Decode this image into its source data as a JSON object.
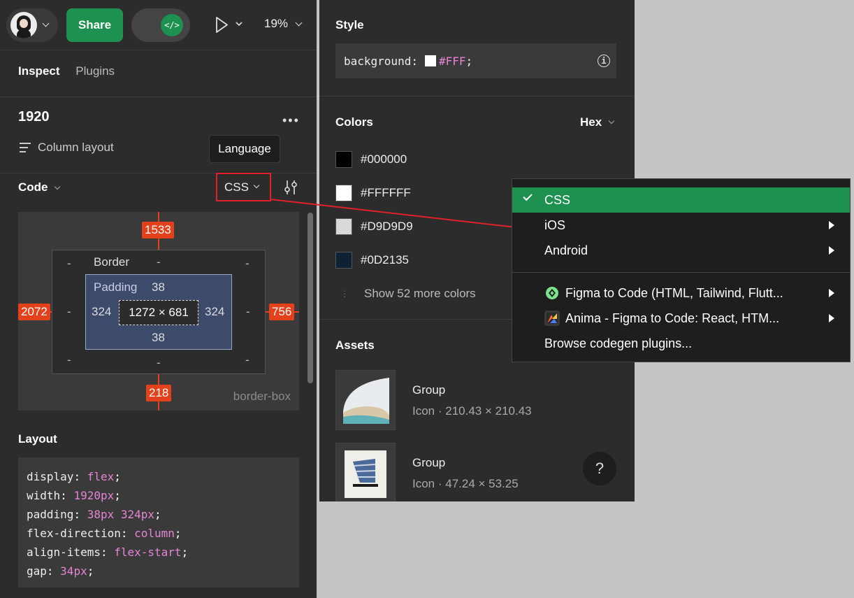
{
  "topbar": {
    "share_label": "Share",
    "zoom_label": "19%"
  },
  "tabs": [
    {
      "label": "Inspect",
      "active": true
    },
    {
      "label": "Plugins",
      "active": false
    }
  ],
  "frame": {
    "name": "1920",
    "layout_label": "Column layout"
  },
  "tooltip": "Language",
  "code_section": {
    "title": "Code",
    "language": "CSS"
  },
  "box_model": {
    "top": "1533",
    "left": "2072",
    "right": "756",
    "bottom": "218",
    "border_label": "Border",
    "padding_label": "Padding",
    "padding_top": "38",
    "padding_left": "324",
    "padding_right": "324",
    "padding_bottom": "38",
    "content_size": "1272 × 681",
    "dash": "-",
    "box_sizing": "border-box"
  },
  "layout_section": {
    "title": "Layout",
    "lines": [
      {
        "prop": "display",
        "value": "flex"
      },
      {
        "prop": "width",
        "value": "1920px"
      },
      {
        "prop": "padding",
        "value": "38px 324px"
      },
      {
        "prop": "flex-direction",
        "value": "column"
      },
      {
        "prop": "align-items",
        "value": "flex-start"
      },
      {
        "prop": "gap",
        "value": "34px"
      }
    ]
  },
  "style_section": {
    "title": "Style",
    "prop": "background:",
    "value": "#FFF",
    "swatch_color": "#FFFFFF"
  },
  "colors_section": {
    "title": "Colors",
    "format": "Hex",
    "items": [
      {
        "hex": "#000000",
        "color": "#000000"
      },
      {
        "hex": "#FFFFFF",
        "color": "#FFFFFF"
      },
      {
        "hex": "#D9D9D9",
        "color": "#D9D9D9"
      },
      {
        "hex": "#0D2135",
        "color": "#0D2135"
      }
    ],
    "more_label": "Show 52 more colors"
  },
  "assets_section": {
    "title": "Assets",
    "items": [
      {
        "name": "Group",
        "meta": "Icon · 210.43 × 210.43"
      },
      {
        "name": "Group",
        "meta": "Icon · 47.24 × 53.25"
      }
    ]
  },
  "help_label": "?",
  "language_menu": {
    "items": [
      {
        "label": "CSS",
        "selected": true
      },
      {
        "label": "iOS",
        "submenu": true
      },
      {
        "label": "Android",
        "submenu": true
      }
    ],
    "plugins": [
      {
        "label": "Figma to Code (HTML, Tailwind, Flutt...",
        "icon": "figma-to-code-icon"
      },
      {
        "label": "Anima - Figma to Code: React, HTM...",
        "icon": "anima-icon"
      }
    ],
    "browse_label": "Browse codegen plugins..."
  },
  "colors": {
    "accent_green": "#1E9150",
    "annotation_red": "#E0212B",
    "measure_orange": "#E3411C",
    "panel_bg": "#2C2C2C"
  }
}
